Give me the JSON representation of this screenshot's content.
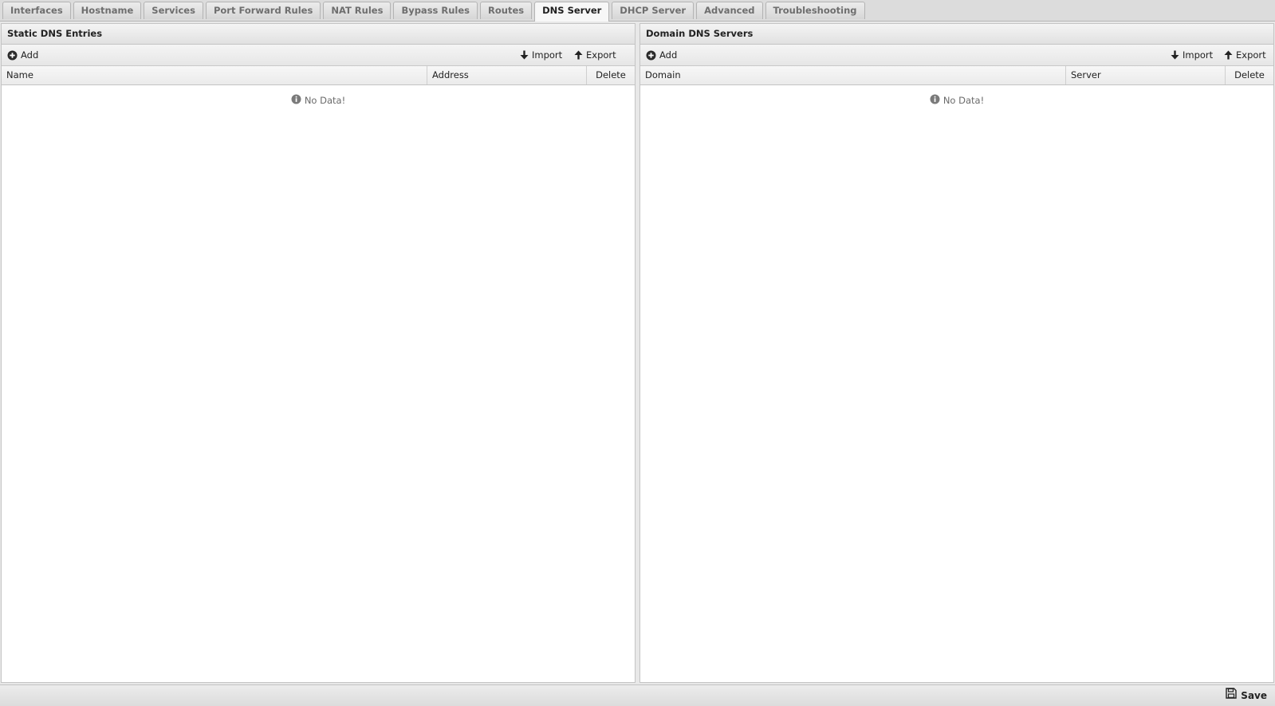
{
  "tabs": [
    {
      "label": "Interfaces"
    },
    {
      "label": "Hostname"
    },
    {
      "label": "Services"
    },
    {
      "label": "Port Forward Rules"
    },
    {
      "label": "NAT Rules"
    },
    {
      "label": "Bypass Rules"
    },
    {
      "label": "Routes"
    },
    {
      "label": "DNS Server",
      "active": true
    },
    {
      "label": "DHCP Server"
    },
    {
      "label": "Advanced"
    },
    {
      "label": "Troubleshooting"
    }
  ],
  "static_dns": {
    "title": "Static DNS Entries",
    "toolbar": {
      "add": "Add",
      "import": "Import",
      "export": "Export"
    },
    "columns": {
      "name": "Name",
      "address": "Address",
      "delete": "Delete"
    },
    "empty_text": "No Data!"
  },
  "domain_dns": {
    "title": "Domain DNS Servers",
    "toolbar": {
      "add": "Add",
      "import": "Import",
      "export": "Export"
    },
    "columns": {
      "domain": "Domain",
      "server": "Server",
      "delete": "Delete"
    },
    "empty_text": "No Data!"
  },
  "footer": {
    "save": "Save"
  },
  "icons": {
    "add": "plus-circle-icon",
    "import": "arrow-down-icon",
    "export": "arrow-up-icon",
    "empty": "info-circle-icon",
    "save": "floppy-disk-icon"
  }
}
